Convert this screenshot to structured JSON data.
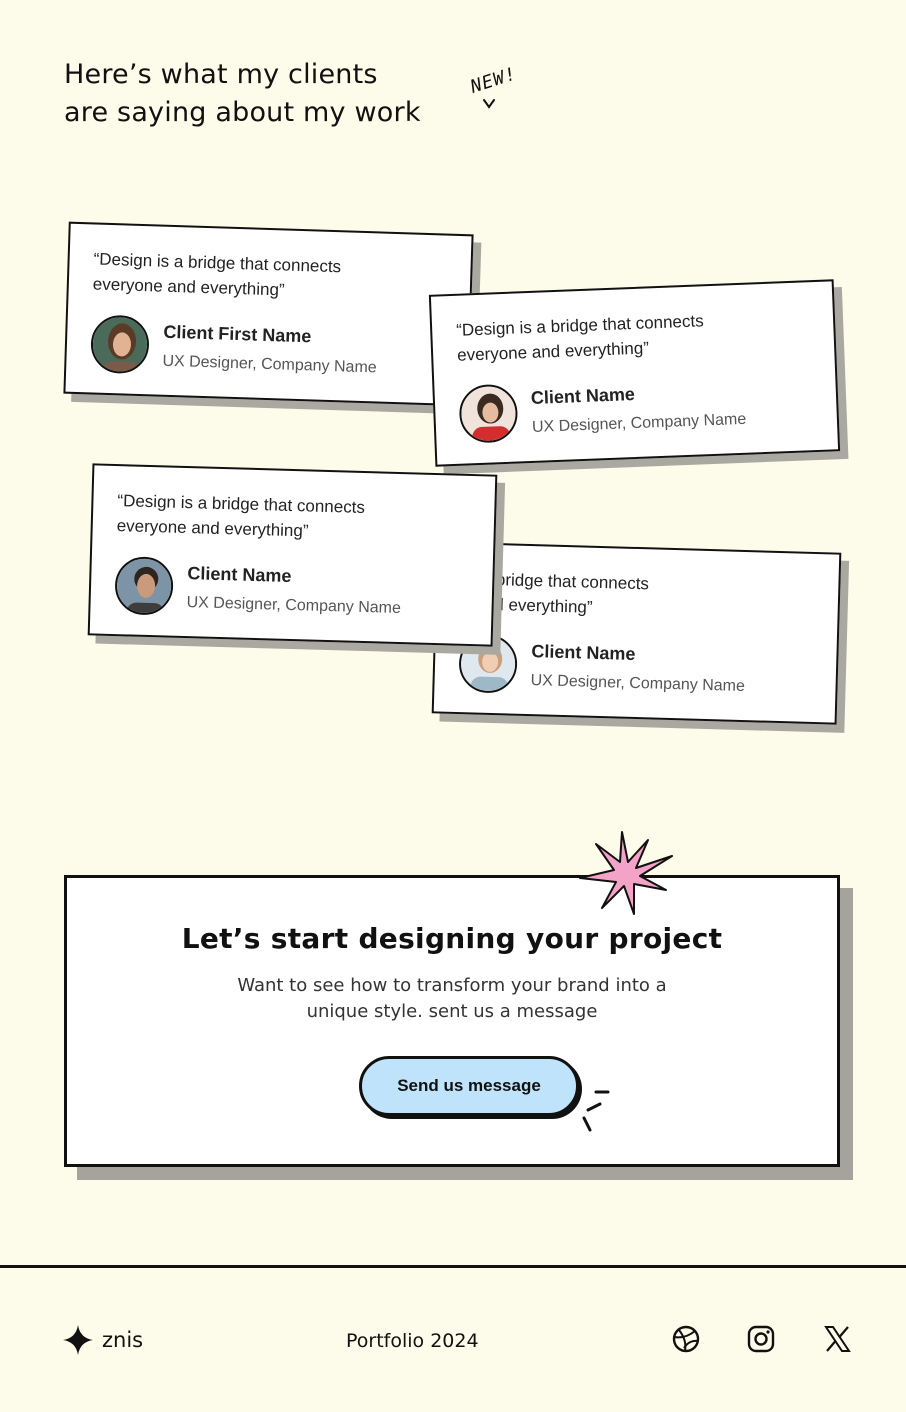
{
  "header": {
    "line1": "Here’s what my clients",
    "line2": "are saying about my work",
    "badge": "NEW!"
  },
  "testimonials": [
    {
      "quote": "“Design is a bridge that connects everyone and everything”",
      "name": "Client First Name",
      "role": "UX Designer, Company Name"
    },
    {
      "quote": "“Design is a bridge that connects everyone and everything”",
      "name": "Client Name",
      "role": "UX Designer, Company Name"
    },
    {
      "quote": "“Design is a bridge that connects everyone and everything”",
      "name": "Client Name",
      "role": "UX Designer, Company Name"
    },
    {
      "quote": "“Design is a bridge that connects everyone and everything”",
      "name": "Client Name",
      "role": "UX Designer, Company Name"
    }
  ],
  "cta": {
    "title": "Let’s start designing your project",
    "sub1": "Want to see how to transform your brand into a",
    "sub2": "unique style. sent us a message",
    "button": "Send us message",
    "button_color": "#bfe3fb",
    "accent_color": "#f4a3c8"
  },
  "footer": {
    "logo": "znis",
    "center": "Portfolio 2024",
    "icons": [
      "dribbble-icon",
      "instagram-icon",
      "x-icon"
    ]
  }
}
